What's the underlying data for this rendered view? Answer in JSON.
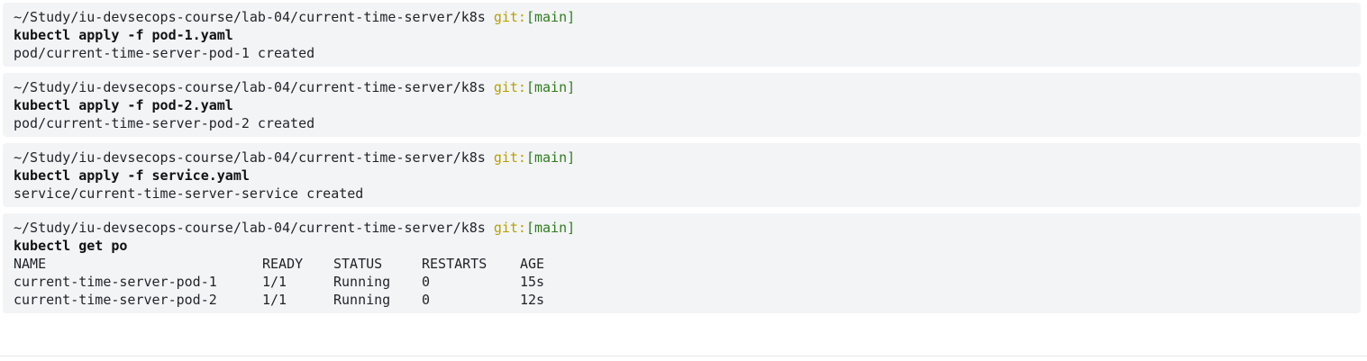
{
  "prompt": {
    "path": "~/Study/iu-devsecops-course/lab-04/current-time-server/k8s",
    "git_label": "git:",
    "git_branch": "[main]"
  },
  "blocks": [
    {
      "command": "kubectl apply -f pod-1.yaml",
      "output": "pod/current-time-server-pod-1 created"
    },
    {
      "command": "kubectl apply -f pod-2.yaml",
      "output": "pod/current-time-server-pod-2 created"
    },
    {
      "command": "kubectl apply -f service.yaml",
      "output": "service/current-time-server-service created"
    },
    {
      "command": "kubectl get po",
      "table": {
        "headers": [
          "NAME",
          "READY",
          "STATUS",
          "RESTARTS",
          "AGE"
        ],
        "rows": [
          [
            "current-time-server-pod-1",
            "1/1",
            "Running",
            "0",
            "15s"
          ],
          [
            "current-time-server-pod-2",
            "1/1",
            "Running",
            "0",
            "12s"
          ]
        ]
      }
    }
  ],
  "colors": {
    "block_background": "#f3f4f6",
    "git_label": "#b5a100",
    "git_branch": "#2f7d1f"
  }
}
